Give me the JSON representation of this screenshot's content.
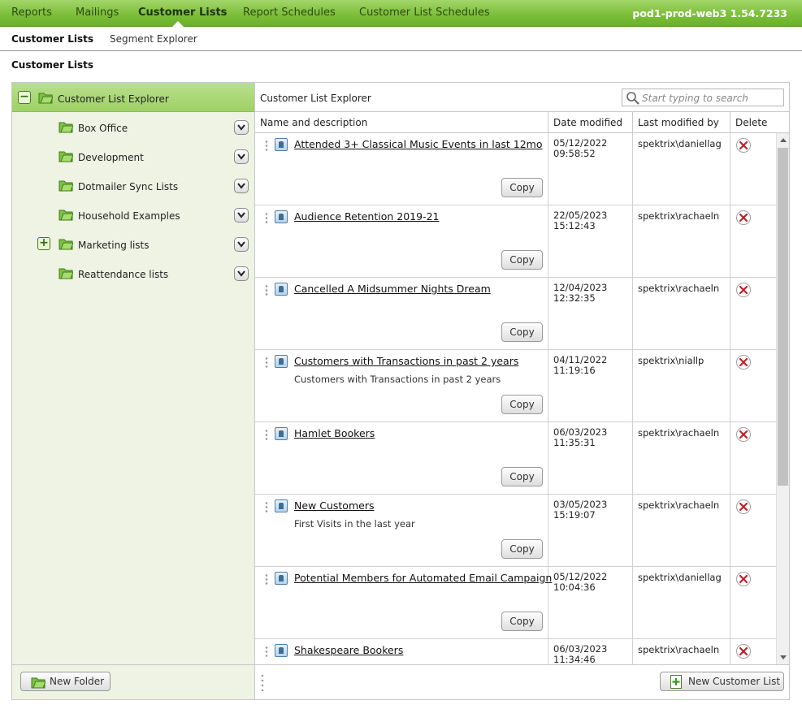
{
  "topnav": {
    "tabs": [
      "Reports",
      "Mailings",
      "Customer Lists",
      "Report Schedules",
      "Customer List Schedules"
    ],
    "active": "Customer Lists",
    "server": "pod1-prod-web3 1.54.7233"
  },
  "subnav": {
    "items": [
      "Customer Lists",
      "Segment Explorer"
    ],
    "active": "Customer Lists"
  },
  "page_title": "Customer Lists",
  "tree": {
    "root_label": "Customer List Explorer",
    "folders": [
      {
        "label": "Box Office",
        "expandable": false
      },
      {
        "label": "Development",
        "expandable": false
      },
      {
        "label": "Dotmailer Sync Lists",
        "expandable": false
      },
      {
        "label": "Household Examples",
        "expandable": false
      },
      {
        "label": "Marketing lists",
        "expandable": true
      },
      {
        "label": "Reattendance lists",
        "expandable": false
      }
    ],
    "new_folder_label": "New Folder"
  },
  "panel": {
    "title": "Customer List Explorer",
    "search_placeholder": "Start typing to search",
    "columns": [
      "Name and description",
      "Date modified",
      "Last modified by",
      "Delete"
    ],
    "copy_label": "Copy",
    "new_list_label": "New Customer List",
    "rows": [
      {
        "name": "Attended 3+ Classical Music Events in last 12mo",
        "description": "",
        "date": "05/12/2022",
        "time": "09:58:52",
        "by": "spektrix\\daniellag"
      },
      {
        "name": "Audience Retention 2019-21",
        "description": "",
        "date": "22/05/2023",
        "time": "15:12:43",
        "by": "spektrix\\rachaeln"
      },
      {
        "name": "Cancelled A Midsummer Nights Dream",
        "description": "",
        "date": "12/04/2023",
        "time": "12:32:35",
        "by": "spektrix\\rachaeln"
      },
      {
        "name": "Customers with Transactions in past 2 years",
        "description": "Customers with Transactions in past 2 years",
        "date": "04/11/2022",
        "time": "11:19:16",
        "by": "spektrix\\niallp"
      },
      {
        "name": "Hamlet Bookers",
        "description": "",
        "date": "06/03/2023",
        "time": "11:35:31",
        "by": "spektrix\\rachaeln"
      },
      {
        "name": "New Customers",
        "description": "First Visits in the last year",
        "date": "03/05/2023",
        "time": "15:19:07",
        "by": "spektrix\\rachaeln"
      },
      {
        "name": "Potential Members for Automated Email Campaign",
        "description": "",
        "date": "05/12/2022",
        "time": "10:04:36",
        "by": "spektrix\\daniellag"
      },
      {
        "name": "Shakespeare Bookers",
        "description": "",
        "date": "06/03/2023",
        "time": "11:34:46",
        "by": "spektrix\\rachaeln"
      }
    ]
  },
  "colors": {
    "nav_green": "#7dbf3a",
    "tree_bg": "#eef3e3",
    "delete_red": "#c0202a"
  }
}
